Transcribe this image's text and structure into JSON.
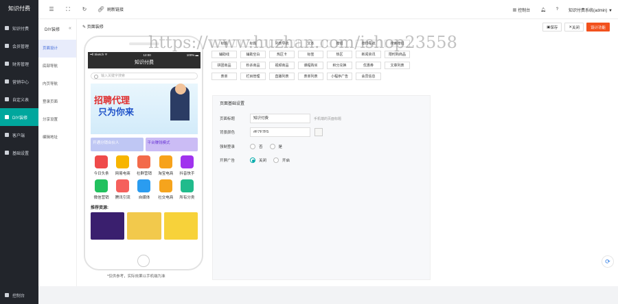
{
  "sidebar": {
    "logo": "知识付费",
    "items": [
      {
        "label": "知识付费",
        "icon": "book-icon"
      },
      {
        "label": "会员管理",
        "icon": "user-icon"
      },
      {
        "label": "财务管理",
        "icon": "wallet-icon"
      },
      {
        "label": "营销中心",
        "icon": "megaphone-icon"
      },
      {
        "label": "自定义表",
        "icon": "table-icon"
      },
      {
        "label": "DIY装修",
        "icon": "brush-icon",
        "active": true
      },
      {
        "label": "客户端",
        "icon": "grid-icon"
      },
      {
        "label": "基础设置",
        "icon": "gear-icon"
      }
    ],
    "bottom": "控制台"
  },
  "topbar": {
    "refresh_link": "刷新链接",
    "console": "控制台",
    "user": "知识付费系统(admin) ▼"
  },
  "subnav": {
    "title": "DIY装修",
    "items": [
      "页面设计",
      "底部导航",
      "内页导航",
      "登录页面",
      "分享设置",
      "编辑地址"
    ],
    "active_index": 0
  },
  "main": {
    "crumb": "页面装修",
    "buttons": {
      "save": "保存",
      "close": "关闭",
      "design": "设计功能"
    }
  },
  "phone": {
    "status_left": "••ll Sketch ᯤ",
    "status_time": "12:00",
    "status_right": "100% ▬",
    "title": "知识付费",
    "search_placeholder": "输入关键字搜索",
    "banner_line1": "招聘代理",
    "banner_line2": "只为你来",
    "promo_left": "开通分销合伙人",
    "promo_right": "平台赚钱模式",
    "grid": [
      {
        "label": "今日头条",
        "color": "#ef4a4a"
      },
      {
        "label": "网易电商",
        "color": "#f7b500"
      },
      {
        "label": "社群营销",
        "color": "#f36a4a"
      },
      {
        "label": "淘宝电商",
        "color": "#f7a21b"
      },
      {
        "label": "抖音快手",
        "color": "#a033ee"
      },
      {
        "label": "微信营销",
        "color": "#22c15e"
      },
      {
        "label": "腾讯引流",
        "color": "#f5605c"
      },
      {
        "label": "自媒体",
        "color": "#2a9cf0"
      },
      {
        "label": "社交电商",
        "color": "#f5a41d"
      },
      {
        "label": "所有分类",
        "color": "#21bb8c"
      }
    ],
    "rec_label": "推荐资源:",
    "card_colors": [
      "#3a1f6e",
      "#f2c94c",
      "#f7d23a"
    ],
    "note": "*仅供参考，实际效果以手机端为准"
  },
  "components": [
    "标题",
    "标题",
    "列表导航",
    "文本",
    "按钮",
    "按钮导航",
    "搜索按钮",
    "辅助线",
    "辅助空白",
    "热区卡",
    "标签",
    "热区",
    "新闻资讯",
    "限时购商品",
    "拼团商品",
    "秒杀商品",
    "视频商品",
    "课程购买",
    "积分兑换",
    "优惠券",
    "文章列表",
    "表单",
    "栏目管理",
    "直播列表",
    "表单列表",
    "小程序广告",
    "会员信息"
  ],
  "settings": {
    "title": "页面基础设置",
    "page_title_label": "页面标题",
    "page_title_value": "知识付费",
    "page_title_hint": "手机端的页面标题",
    "bg_label": "背景颜色",
    "bg_value": "#F7F7F5",
    "bg_color": "#F7F7F5",
    "login_label": "强制登录",
    "login_options": [
      "否",
      "是"
    ],
    "ad_label": "开屏广告",
    "ad_options": [
      "关闭",
      "开启"
    ]
  },
  "watermark": "https://www.huzhan.com/ishop23558"
}
